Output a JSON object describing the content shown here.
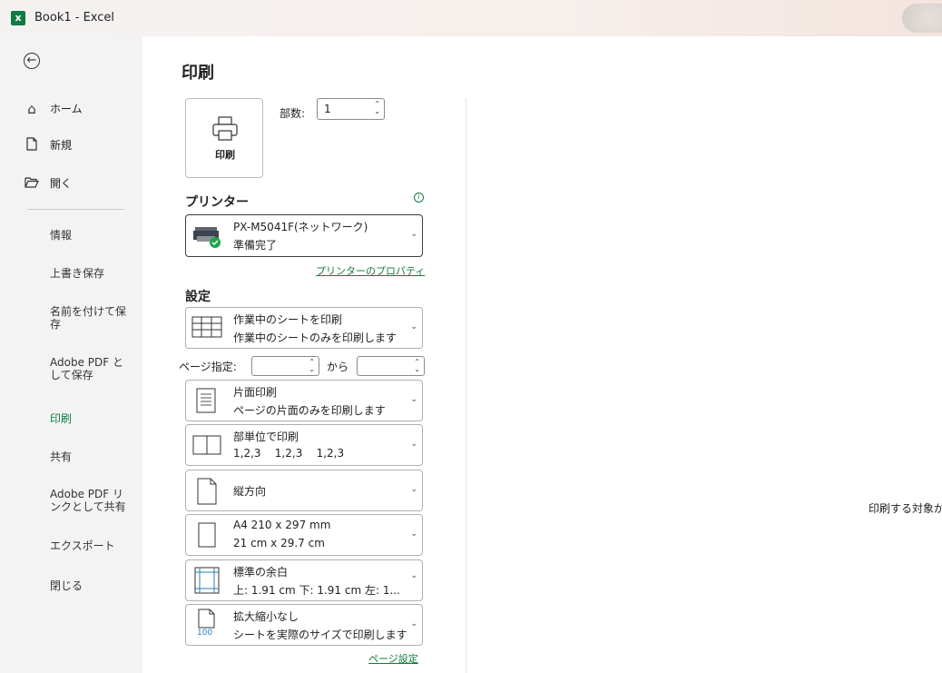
{
  "window": {
    "app_icon": "excel-logo-icon",
    "title": "Book1  -  Excel"
  },
  "sidebar": {
    "back_icon": "back-arrow-icon",
    "top_items": [
      {
        "icon": "home-icon",
        "label": "ホーム"
      },
      {
        "icon": "new-document-icon",
        "label": "新規"
      },
      {
        "icon": "folder-open-icon",
        "label": "開く"
      }
    ],
    "items": [
      {
        "label": "情報"
      },
      {
        "label": "上書き保存"
      },
      {
        "label": "名前を付けて保存"
      },
      {
        "label": "Adobe PDF として保存"
      },
      {
        "label": "印刷",
        "active": true
      },
      {
        "label": "共有"
      },
      {
        "label": "Adobe PDF リンクとして共有"
      },
      {
        "label": "エクスポート"
      },
      {
        "label": "閉じる"
      }
    ]
  },
  "print": {
    "title": "印刷",
    "print_button_label": "印刷",
    "copies_label": "部数:",
    "copies_value": "1",
    "printer_heading": "プリンター",
    "printer_name": "PX-M5041F(ネットワーク)",
    "printer_status": "準備完了",
    "printer_properties_link": "プリンターのプロパティ",
    "settings_heading": "設定",
    "settings": [
      {
        "id": "scope",
        "line1": "作業中のシートを印刷",
        "line2": "作業中のシートのみを印刷します"
      },
      {
        "id": "sides",
        "line1": "片面印刷",
        "line2": "ページの片面のみを印刷します"
      },
      {
        "id": "collate",
        "line1": "部単位で印刷",
        "line2": "1,2,3    1,2,3    1,2,3"
      },
      {
        "id": "orientation",
        "line1": "縦方向"
      },
      {
        "id": "paper",
        "line1": "A4 210 x 297 mm",
        "line2": "21 cm x 29.7 cm"
      },
      {
        "id": "margins",
        "line1": "標準の余白",
        "line2": "上: 1.91 cm 下: 1.91 cm 左: 1..."
      },
      {
        "id": "scaling",
        "line1": "拡大縮小なし",
        "line2": "シートを実際のサイズで印刷します",
        "icon_text": "100"
      }
    ],
    "pages_label": "ページ指定:",
    "pages_to_label": "から",
    "page_setup_link": "ページ設定"
  },
  "preview": {
    "message": "印刷する対象があ"
  },
  "colors": {
    "accent": "#107c41"
  }
}
